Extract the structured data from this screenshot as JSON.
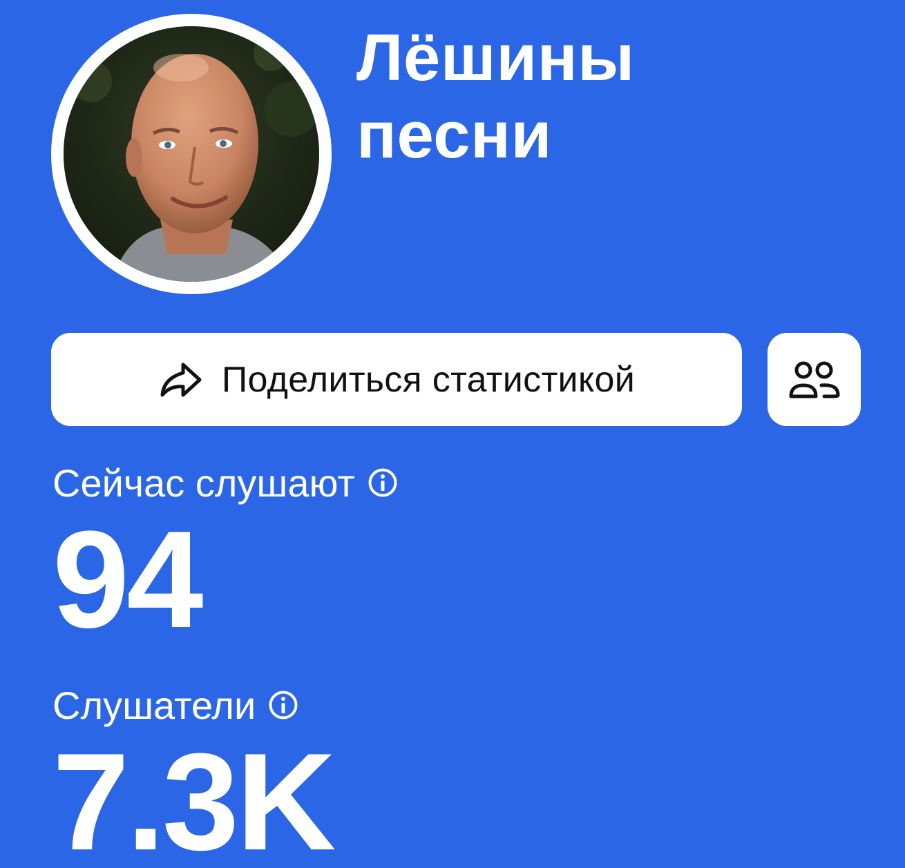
{
  "artist": {
    "title_line1": "Лёшины",
    "title_line2": "песни"
  },
  "actions": {
    "share_label": "Поделиться статистикой",
    "share_icon": "share-arrow-icon",
    "audience_icon": "users-icon"
  },
  "stats": {
    "now_listening": {
      "label": "Сейчас слушают",
      "value": "94",
      "info_icon": "info-icon"
    },
    "listeners": {
      "label": "Слушатели",
      "value": "7.3K",
      "info_icon": "info-icon"
    }
  },
  "colors": {
    "background": "#2b66e6",
    "card": "#ffffff",
    "text_on_card": "#111111",
    "text_on_background": "#ffffff"
  }
}
